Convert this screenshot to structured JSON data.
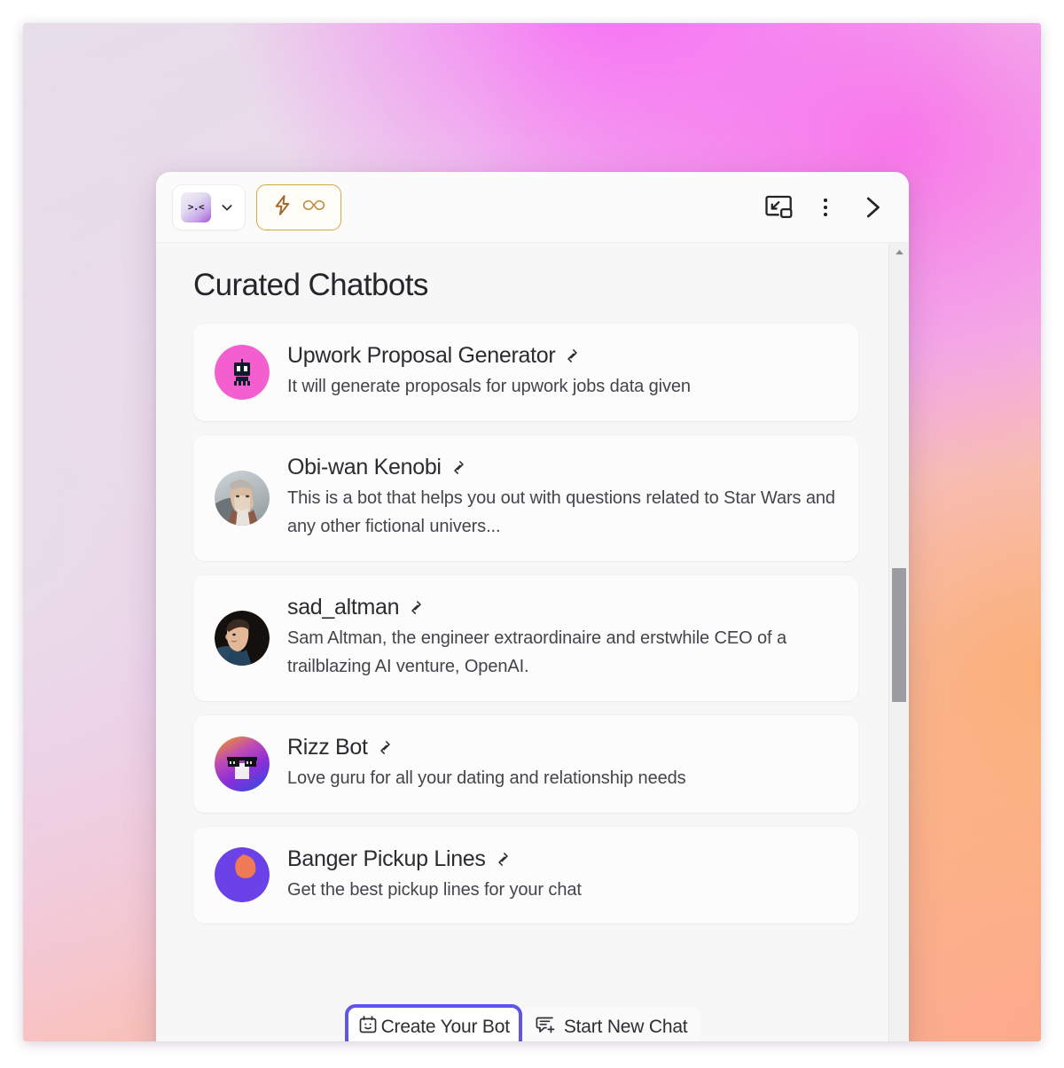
{
  "toolbar": {
    "bot_selector": {
      "avatar_label": ">.<",
      "avatar_icon": "kaomoji-avatar",
      "chevron_icon": "chevron-down-icon"
    },
    "mode_pill": {
      "bolt_icon": "lightning-bolt-icon",
      "infinity_icon": "infinity-icon",
      "border_color": "#d8a93c",
      "icon_color": "#a8682a"
    },
    "minimize_icon": "picture-in-picture-icon",
    "more_icon": "three-dot-menu-icon",
    "collapse_icon": "chevron-right-icon"
  },
  "main": {
    "title": "Curated Chatbots",
    "cards": [
      {
        "name": "Upwork Proposal Generator",
        "description": "It will generate proposals for upwork jobs data given",
        "avatar_icon": "pink-robot-avatar",
        "link_icon": "external-link-icon"
      },
      {
        "name": "Obi-wan Kenobi",
        "description": "This is a bot that helps you out with questions related to Star Wars and any other fictional univers...",
        "avatar_icon": "obiwan-photo-avatar",
        "link_icon": "external-link-icon"
      },
      {
        "name": "sad_altman",
        "description": "Sam Altman, the engineer extraordinaire and erstwhile CEO of a trailblazing AI venture, OpenAI.",
        "avatar_icon": "sam-altman-photo-avatar",
        "link_icon": "external-link-icon"
      },
      {
        "name": "Rizz Bot",
        "description": "Love guru for all your dating and relationship needs",
        "avatar_icon": "sunglasses-gradient-avatar",
        "link_icon": "external-link-icon"
      },
      {
        "name": "Banger Pickup Lines",
        "description": "Get the best pickup lines for your chat",
        "avatar_icon": "purple-orange-blob-avatar",
        "link_icon": "external-link-icon"
      }
    ]
  },
  "actions": {
    "create_bot_label": "Create Your Bot",
    "create_bot_icon": "smiley-box-icon",
    "new_chat_label": "Start New Chat",
    "new_chat_icon": "chat-plus-icon",
    "highlight_color": "#6155e8"
  },
  "scrollbar": {
    "up_icon": "triangle-up-icon",
    "down_icon": "triangle-down-icon",
    "thumb_position_percent": 39,
    "thumb_size_percent": 17
  }
}
